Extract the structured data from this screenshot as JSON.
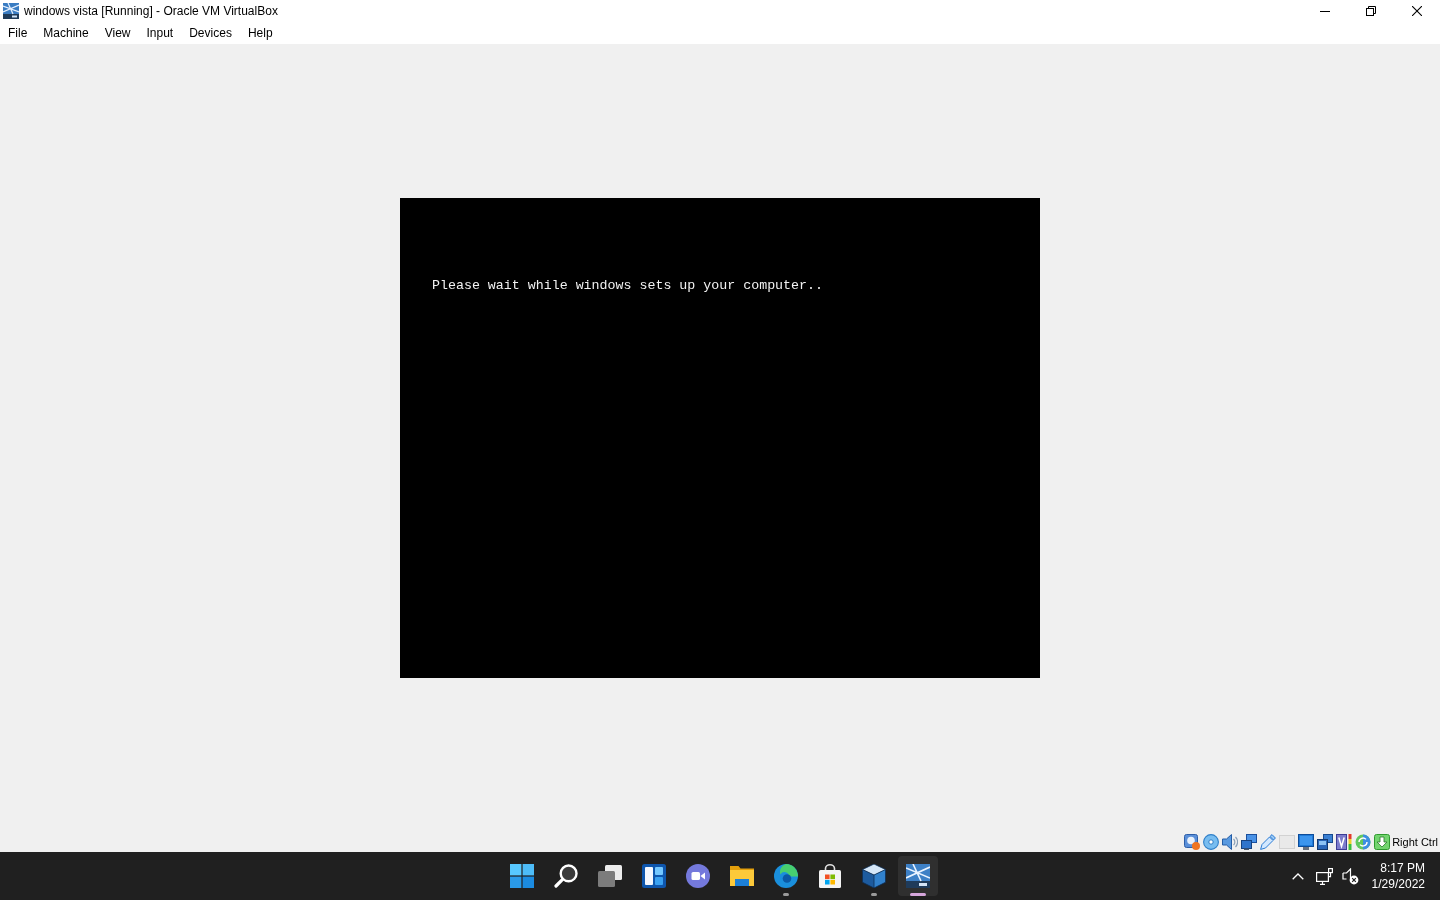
{
  "window": {
    "title": "windows vista [Running] - Oracle VM VirtualBox"
  },
  "menu_bar": {
    "items": [
      "File",
      "Machine",
      "View",
      "Input",
      "Devices",
      "Help"
    ]
  },
  "vm_screen": {
    "message": "Please wait while windows sets up your computer.."
  },
  "status_bar": {
    "indicators": [
      {
        "kind": "harddisk",
        "disabled": false
      },
      {
        "kind": "optical",
        "disabled": false
      },
      {
        "kind": "audio",
        "disabled": false
      },
      {
        "kind": "network",
        "disabled": false
      },
      {
        "kind": "usb",
        "disabled": false
      },
      {
        "kind": "shared",
        "disabled": true
      },
      {
        "kind": "display",
        "disabled": false
      },
      {
        "kind": "recording",
        "disabled": false
      },
      {
        "kind": "features",
        "disabled": false
      },
      {
        "kind": "mouse",
        "disabled": false
      },
      {
        "kind": "keyboard",
        "disabled": false
      }
    ],
    "host_key": "Right Ctrl"
  },
  "taskbar": {
    "apps": [
      {
        "kind": "start",
        "running": false,
        "selected": false
      },
      {
        "kind": "search",
        "running": false,
        "selected": false
      },
      {
        "kind": "taskview",
        "running": false,
        "selected": false
      },
      {
        "kind": "widgets",
        "running": false,
        "selected": false
      },
      {
        "kind": "chat",
        "running": false,
        "selected": false
      },
      {
        "kind": "files",
        "running": false,
        "selected": false
      },
      {
        "kind": "browser",
        "running": true,
        "selected": false
      },
      {
        "kind": "store",
        "running": false,
        "selected": false
      },
      {
        "kind": "virtualbox",
        "running": true,
        "selected": false
      },
      {
        "kind": "vm",
        "running": true,
        "selected": true
      }
    ],
    "tray": {
      "muted": true,
      "time": "8:17 PM",
      "date": "1/29/2022"
    }
  }
}
